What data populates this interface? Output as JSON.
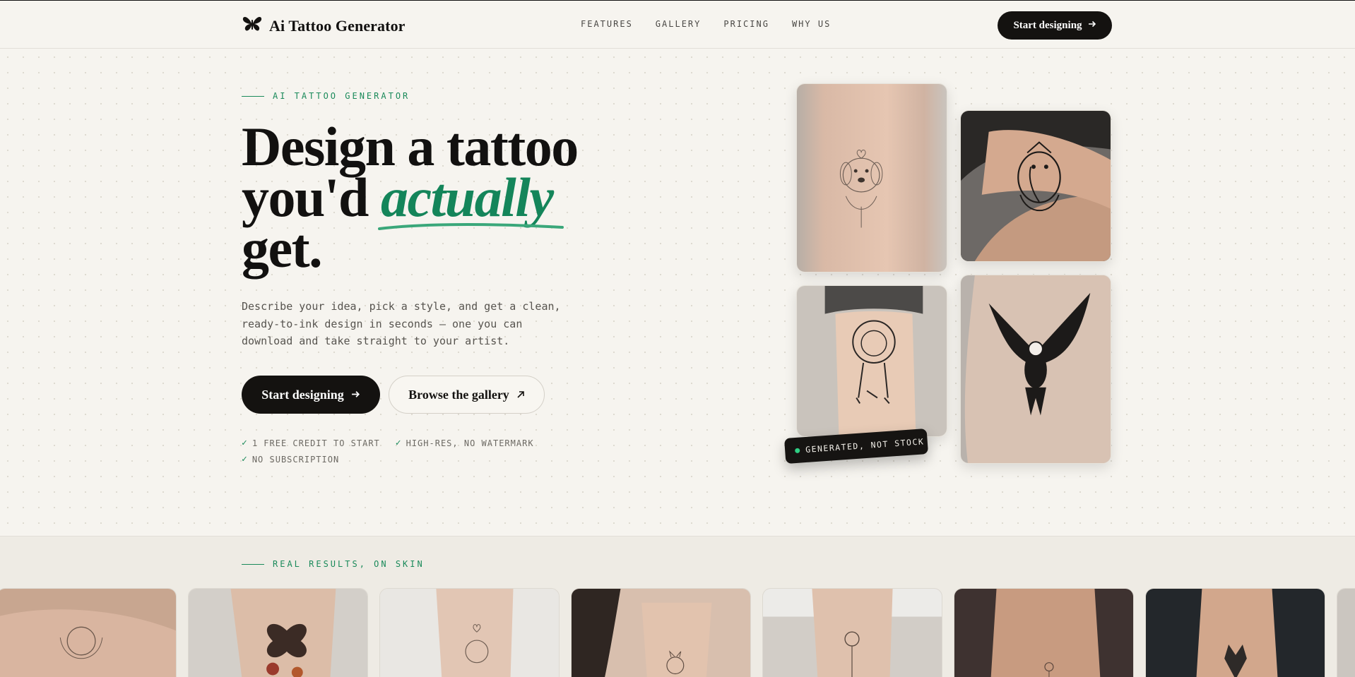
{
  "header": {
    "brand_name": "Ai Tattoo Generator",
    "nav": [
      "FEATURES",
      "GALLERY",
      "PRICING",
      "WHY US"
    ],
    "cta_label": "Start designing"
  },
  "hero": {
    "eyebrow": "AI TATTOO GENERATOR",
    "headline_line1": "Design a tattoo",
    "headline_line2_prefix": "you'd ",
    "headline_accent": "actually",
    "headline_line3": "get.",
    "lede": "Describe your idea, pick a style, and get a clean, ready-to-ink design in seconds — one you can download and take straight to your artist.",
    "primary_cta": "Start designing",
    "secondary_cta": "Browse the gallery",
    "perks": [
      "1 FREE CREDIT TO START",
      "HIGH-RES, NO WATERMARK",
      "NO SUBSCRIPTION"
    ],
    "badge": "GENERATED, NOT STOCK",
    "images": [
      "dog tattoo on forearm",
      "ganesha tattoo on forearm",
      "lion tattoo on forearm",
      "eagle tattoo on forearm"
    ]
  },
  "results": {
    "eyebrow": "REAL RESULTS, ON SKIN",
    "thumbs": [
      "dog tattoo",
      "butterfly and flowers tattoo",
      "dog tattoo",
      "cat tattoo",
      "rose tattoo",
      "small flower tattoo",
      "wolf tattoo",
      "tattoo"
    ]
  },
  "colors": {
    "accent": "#14855a",
    "ink": "#141210",
    "background": "#f6f4ef"
  },
  "icons": [
    "butterfly-icon",
    "arrow-right-icon",
    "arrow-up-right-icon",
    "check-icon"
  ]
}
